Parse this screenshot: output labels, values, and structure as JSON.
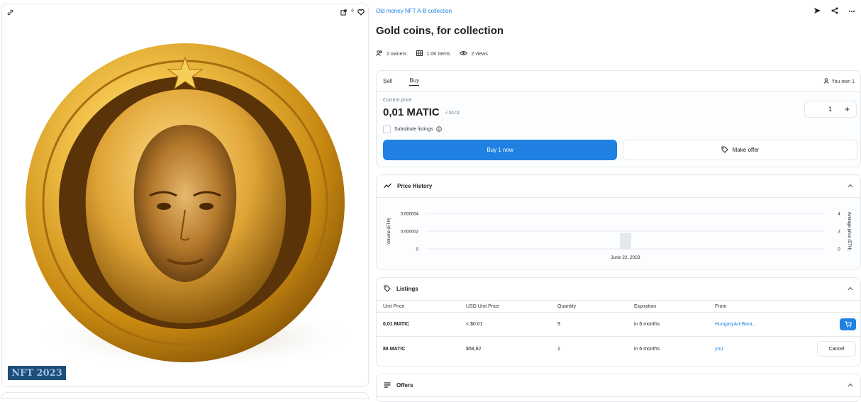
{
  "left_panel": {
    "icons": {
      "chain": "link-icon",
      "expand": "external-link-icon",
      "like": "heart-icon",
      "like_count": "0"
    },
    "watermark": "NFT 2023"
  },
  "collection_link": "Old money NFT A-B collection",
  "title": "Gold coins, for collection",
  "stats": {
    "owners": "2 owners",
    "items": "1.0K items",
    "views": "2 views"
  },
  "header_icons": [
    "send-icon",
    "share-icon",
    "more-icon"
  ],
  "buy_card": {
    "tabs": [
      "Sell",
      "Buy"
    ],
    "active_tab": "Buy",
    "you_own": "You own 1",
    "current_price_label": "Current price",
    "price": "0,01 MATIC",
    "price_usd": "< $0.01",
    "quantity": "1",
    "plus": "+",
    "substitute_label": "Substitute listings",
    "buy_now": "Buy 1 now",
    "make_offer": "Make offer"
  },
  "price_history": {
    "title": "Price History",
    "chevron": "^"
  },
  "chart_data": {
    "type": "bar",
    "categories": [
      "June 22, 2023"
    ],
    "values": [
      1.8e-06
    ],
    "xlabel": "",
    "ylabel": "Volume (ETH)",
    "y2label": "Average price (ETH)",
    "ylim": [
      0,
      4e-06
    ],
    "y_ticks": [
      "0.000004",
      "0.000002",
      "0"
    ],
    "y2_ticks": [
      "4",
      "2",
      "0"
    ],
    "x_tick": "June 22, 2023",
    "grid": true
  },
  "listings": {
    "title": "Listings",
    "columns": [
      "Unit Price",
      "USD Unit Price",
      "Quantity",
      "Expiration",
      "From"
    ],
    "rows": [
      {
        "unit_price": "0,01 MATIC",
        "usd": "< $0.01",
        "quantity": "9",
        "expiration": "in 6 months",
        "from": "HungaryArt-Bara..."
      },
      {
        "unit_price": "88 MATIC",
        "usd": "$58,82",
        "quantity": "1",
        "expiration": "in 6 months",
        "from": "you",
        "action": "Cancel"
      }
    ]
  },
  "offers": {
    "title": "Offers"
  }
}
